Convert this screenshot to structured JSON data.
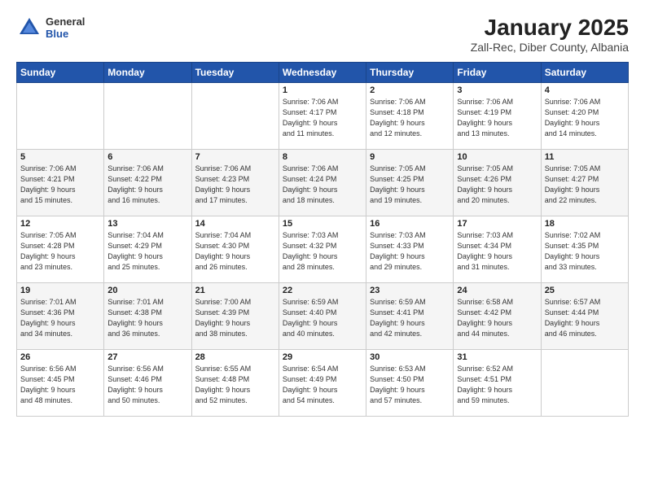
{
  "header": {
    "logo_general": "General",
    "logo_blue": "Blue",
    "title": "January 2025",
    "subtitle": "Zall-Rec, Diber County, Albania"
  },
  "calendar": {
    "days_of_week": [
      "Sunday",
      "Monday",
      "Tuesday",
      "Wednesday",
      "Thursday",
      "Friday",
      "Saturday"
    ],
    "weeks": [
      [
        {
          "day": "",
          "info": ""
        },
        {
          "day": "",
          "info": ""
        },
        {
          "day": "",
          "info": ""
        },
        {
          "day": "1",
          "info": "Sunrise: 7:06 AM\nSunset: 4:17 PM\nDaylight: 9 hours\nand 11 minutes."
        },
        {
          "day": "2",
          "info": "Sunrise: 7:06 AM\nSunset: 4:18 PM\nDaylight: 9 hours\nand 12 minutes."
        },
        {
          "day": "3",
          "info": "Sunrise: 7:06 AM\nSunset: 4:19 PM\nDaylight: 9 hours\nand 13 minutes."
        },
        {
          "day": "4",
          "info": "Sunrise: 7:06 AM\nSunset: 4:20 PM\nDaylight: 9 hours\nand 14 minutes."
        }
      ],
      [
        {
          "day": "5",
          "info": "Sunrise: 7:06 AM\nSunset: 4:21 PM\nDaylight: 9 hours\nand 15 minutes."
        },
        {
          "day": "6",
          "info": "Sunrise: 7:06 AM\nSunset: 4:22 PM\nDaylight: 9 hours\nand 16 minutes."
        },
        {
          "day": "7",
          "info": "Sunrise: 7:06 AM\nSunset: 4:23 PM\nDaylight: 9 hours\nand 17 minutes."
        },
        {
          "day": "8",
          "info": "Sunrise: 7:06 AM\nSunset: 4:24 PM\nDaylight: 9 hours\nand 18 minutes."
        },
        {
          "day": "9",
          "info": "Sunrise: 7:05 AM\nSunset: 4:25 PM\nDaylight: 9 hours\nand 19 minutes."
        },
        {
          "day": "10",
          "info": "Sunrise: 7:05 AM\nSunset: 4:26 PM\nDaylight: 9 hours\nand 20 minutes."
        },
        {
          "day": "11",
          "info": "Sunrise: 7:05 AM\nSunset: 4:27 PM\nDaylight: 9 hours\nand 22 minutes."
        }
      ],
      [
        {
          "day": "12",
          "info": "Sunrise: 7:05 AM\nSunset: 4:28 PM\nDaylight: 9 hours\nand 23 minutes."
        },
        {
          "day": "13",
          "info": "Sunrise: 7:04 AM\nSunset: 4:29 PM\nDaylight: 9 hours\nand 25 minutes."
        },
        {
          "day": "14",
          "info": "Sunrise: 7:04 AM\nSunset: 4:30 PM\nDaylight: 9 hours\nand 26 minutes."
        },
        {
          "day": "15",
          "info": "Sunrise: 7:03 AM\nSunset: 4:32 PM\nDaylight: 9 hours\nand 28 minutes."
        },
        {
          "day": "16",
          "info": "Sunrise: 7:03 AM\nSunset: 4:33 PM\nDaylight: 9 hours\nand 29 minutes."
        },
        {
          "day": "17",
          "info": "Sunrise: 7:03 AM\nSunset: 4:34 PM\nDaylight: 9 hours\nand 31 minutes."
        },
        {
          "day": "18",
          "info": "Sunrise: 7:02 AM\nSunset: 4:35 PM\nDaylight: 9 hours\nand 33 minutes."
        }
      ],
      [
        {
          "day": "19",
          "info": "Sunrise: 7:01 AM\nSunset: 4:36 PM\nDaylight: 9 hours\nand 34 minutes."
        },
        {
          "day": "20",
          "info": "Sunrise: 7:01 AM\nSunset: 4:38 PM\nDaylight: 9 hours\nand 36 minutes."
        },
        {
          "day": "21",
          "info": "Sunrise: 7:00 AM\nSunset: 4:39 PM\nDaylight: 9 hours\nand 38 minutes."
        },
        {
          "day": "22",
          "info": "Sunrise: 6:59 AM\nSunset: 4:40 PM\nDaylight: 9 hours\nand 40 minutes."
        },
        {
          "day": "23",
          "info": "Sunrise: 6:59 AM\nSunset: 4:41 PM\nDaylight: 9 hours\nand 42 minutes."
        },
        {
          "day": "24",
          "info": "Sunrise: 6:58 AM\nSunset: 4:42 PM\nDaylight: 9 hours\nand 44 minutes."
        },
        {
          "day": "25",
          "info": "Sunrise: 6:57 AM\nSunset: 4:44 PM\nDaylight: 9 hours\nand 46 minutes."
        }
      ],
      [
        {
          "day": "26",
          "info": "Sunrise: 6:56 AM\nSunset: 4:45 PM\nDaylight: 9 hours\nand 48 minutes."
        },
        {
          "day": "27",
          "info": "Sunrise: 6:56 AM\nSunset: 4:46 PM\nDaylight: 9 hours\nand 50 minutes."
        },
        {
          "day": "28",
          "info": "Sunrise: 6:55 AM\nSunset: 4:48 PM\nDaylight: 9 hours\nand 52 minutes."
        },
        {
          "day": "29",
          "info": "Sunrise: 6:54 AM\nSunset: 4:49 PM\nDaylight: 9 hours\nand 54 minutes."
        },
        {
          "day": "30",
          "info": "Sunrise: 6:53 AM\nSunset: 4:50 PM\nDaylight: 9 hours\nand 57 minutes."
        },
        {
          "day": "31",
          "info": "Sunrise: 6:52 AM\nSunset: 4:51 PM\nDaylight: 9 hours\nand 59 minutes."
        },
        {
          "day": "",
          "info": ""
        }
      ]
    ]
  }
}
